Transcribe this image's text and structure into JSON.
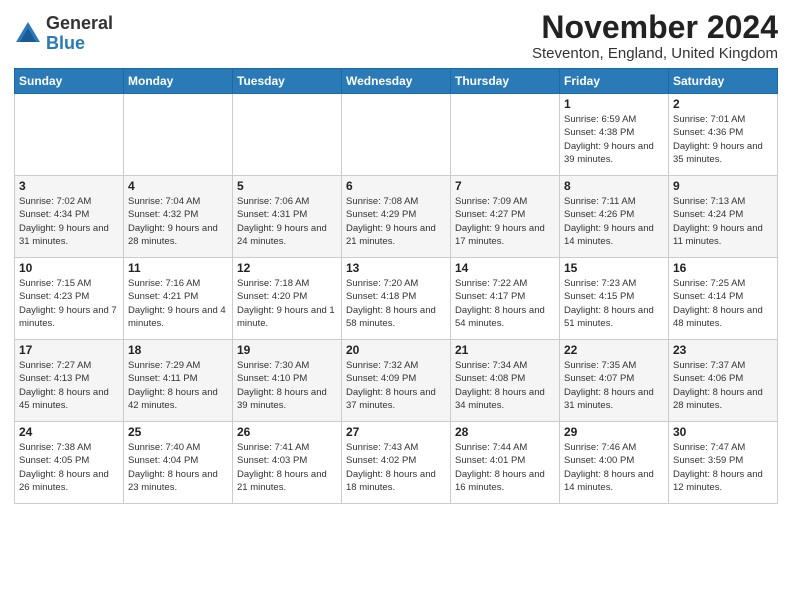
{
  "logo": {
    "general": "General",
    "blue": "Blue"
  },
  "title": "November 2024",
  "location": "Steventon, England, United Kingdom",
  "weekdays": [
    "Sunday",
    "Monday",
    "Tuesday",
    "Wednesday",
    "Thursday",
    "Friday",
    "Saturday"
  ],
  "weeks": [
    [
      {
        "day": "",
        "info": ""
      },
      {
        "day": "",
        "info": ""
      },
      {
        "day": "",
        "info": ""
      },
      {
        "day": "",
        "info": ""
      },
      {
        "day": "",
        "info": ""
      },
      {
        "day": "1",
        "info": "Sunrise: 6:59 AM\nSunset: 4:38 PM\nDaylight: 9 hours\nand 39 minutes."
      },
      {
        "day": "2",
        "info": "Sunrise: 7:01 AM\nSunset: 4:36 PM\nDaylight: 9 hours\nand 35 minutes."
      }
    ],
    [
      {
        "day": "3",
        "info": "Sunrise: 7:02 AM\nSunset: 4:34 PM\nDaylight: 9 hours\nand 31 minutes."
      },
      {
        "day": "4",
        "info": "Sunrise: 7:04 AM\nSunset: 4:32 PM\nDaylight: 9 hours\nand 28 minutes."
      },
      {
        "day": "5",
        "info": "Sunrise: 7:06 AM\nSunset: 4:31 PM\nDaylight: 9 hours\nand 24 minutes."
      },
      {
        "day": "6",
        "info": "Sunrise: 7:08 AM\nSunset: 4:29 PM\nDaylight: 9 hours\nand 21 minutes."
      },
      {
        "day": "7",
        "info": "Sunrise: 7:09 AM\nSunset: 4:27 PM\nDaylight: 9 hours\nand 17 minutes."
      },
      {
        "day": "8",
        "info": "Sunrise: 7:11 AM\nSunset: 4:26 PM\nDaylight: 9 hours\nand 14 minutes."
      },
      {
        "day": "9",
        "info": "Sunrise: 7:13 AM\nSunset: 4:24 PM\nDaylight: 9 hours\nand 11 minutes."
      }
    ],
    [
      {
        "day": "10",
        "info": "Sunrise: 7:15 AM\nSunset: 4:23 PM\nDaylight: 9 hours\nand 7 minutes."
      },
      {
        "day": "11",
        "info": "Sunrise: 7:16 AM\nSunset: 4:21 PM\nDaylight: 9 hours\nand 4 minutes."
      },
      {
        "day": "12",
        "info": "Sunrise: 7:18 AM\nSunset: 4:20 PM\nDaylight: 9 hours\nand 1 minute."
      },
      {
        "day": "13",
        "info": "Sunrise: 7:20 AM\nSunset: 4:18 PM\nDaylight: 8 hours\nand 58 minutes."
      },
      {
        "day": "14",
        "info": "Sunrise: 7:22 AM\nSunset: 4:17 PM\nDaylight: 8 hours\nand 54 minutes."
      },
      {
        "day": "15",
        "info": "Sunrise: 7:23 AM\nSunset: 4:15 PM\nDaylight: 8 hours\nand 51 minutes."
      },
      {
        "day": "16",
        "info": "Sunrise: 7:25 AM\nSunset: 4:14 PM\nDaylight: 8 hours\nand 48 minutes."
      }
    ],
    [
      {
        "day": "17",
        "info": "Sunrise: 7:27 AM\nSunset: 4:13 PM\nDaylight: 8 hours\nand 45 minutes."
      },
      {
        "day": "18",
        "info": "Sunrise: 7:29 AM\nSunset: 4:11 PM\nDaylight: 8 hours\nand 42 minutes."
      },
      {
        "day": "19",
        "info": "Sunrise: 7:30 AM\nSunset: 4:10 PM\nDaylight: 8 hours\nand 39 minutes."
      },
      {
        "day": "20",
        "info": "Sunrise: 7:32 AM\nSunset: 4:09 PM\nDaylight: 8 hours\nand 37 minutes."
      },
      {
        "day": "21",
        "info": "Sunrise: 7:34 AM\nSunset: 4:08 PM\nDaylight: 8 hours\nand 34 minutes."
      },
      {
        "day": "22",
        "info": "Sunrise: 7:35 AM\nSunset: 4:07 PM\nDaylight: 8 hours\nand 31 minutes."
      },
      {
        "day": "23",
        "info": "Sunrise: 7:37 AM\nSunset: 4:06 PM\nDaylight: 8 hours\nand 28 minutes."
      }
    ],
    [
      {
        "day": "24",
        "info": "Sunrise: 7:38 AM\nSunset: 4:05 PM\nDaylight: 8 hours\nand 26 minutes."
      },
      {
        "day": "25",
        "info": "Sunrise: 7:40 AM\nSunset: 4:04 PM\nDaylight: 8 hours\nand 23 minutes."
      },
      {
        "day": "26",
        "info": "Sunrise: 7:41 AM\nSunset: 4:03 PM\nDaylight: 8 hours\nand 21 minutes."
      },
      {
        "day": "27",
        "info": "Sunrise: 7:43 AM\nSunset: 4:02 PM\nDaylight: 8 hours\nand 18 minutes."
      },
      {
        "day": "28",
        "info": "Sunrise: 7:44 AM\nSunset: 4:01 PM\nDaylight: 8 hours\nand 16 minutes."
      },
      {
        "day": "29",
        "info": "Sunrise: 7:46 AM\nSunset: 4:00 PM\nDaylight: 8 hours\nand 14 minutes."
      },
      {
        "day": "30",
        "info": "Sunrise: 7:47 AM\nSunset: 3:59 PM\nDaylight: 8 hours\nand 12 minutes."
      }
    ]
  ]
}
